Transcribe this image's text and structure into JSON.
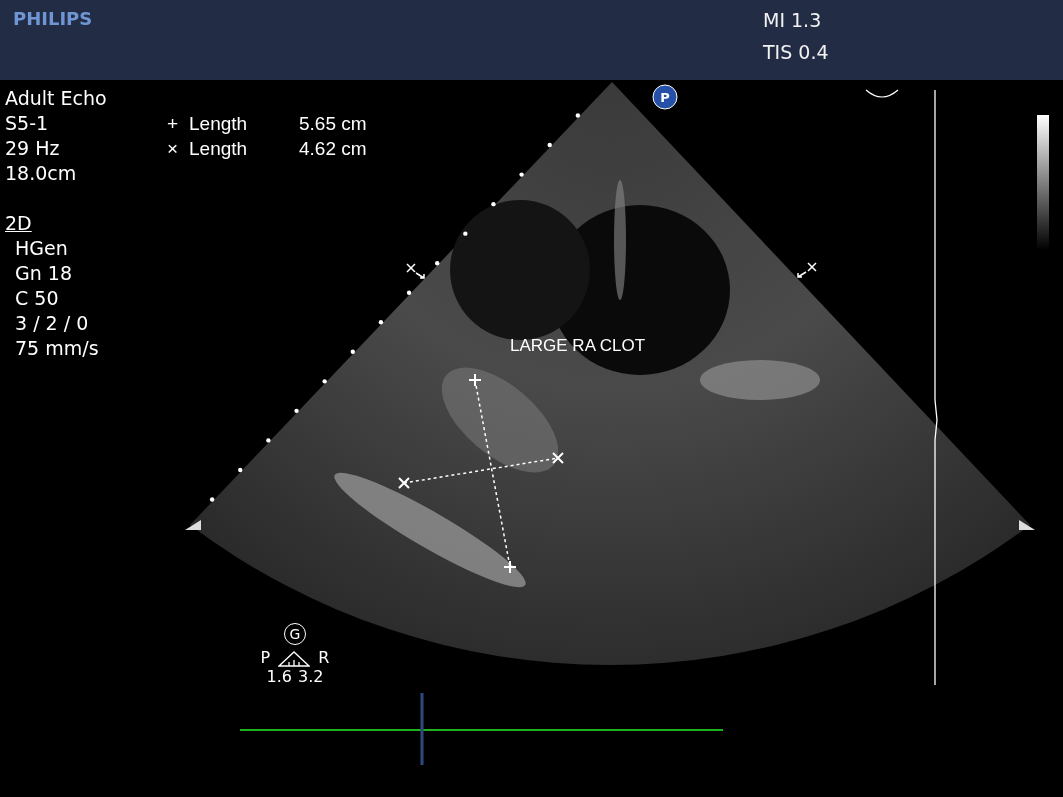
{
  "header": {
    "logo": "PHILIPS",
    "indices": [
      "MI 1.3",
      "TIS 0.4"
    ]
  },
  "preset": [
    "Adult Echo",
    "S5-1",
    "29 Hz",
    "18.0cm"
  ],
  "measurements": [
    {
      "marker": "+",
      "label": "Length",
      "value": "5.65 cm"
    },
    {
      "marker": "×",
      "label": "Length",
      "value": "4.62 cm"
    }
  ],
  "mode": {
    "title": "2D",
    "settings": [
      "HGen",
      "Gn 18",
      "C 50",
      "3 / 2 / 0",
      "75 mm/s"
    ]
  },
  "image": {
    "badge": "P",
    "annotation": "LARGE RA CLOT"
  },
  "orientation": {
    "badge": "G",
    "left": "P",
    "right": "R",
    "values": [
      "1.6",
      "3.2"
    ]
  }
}
